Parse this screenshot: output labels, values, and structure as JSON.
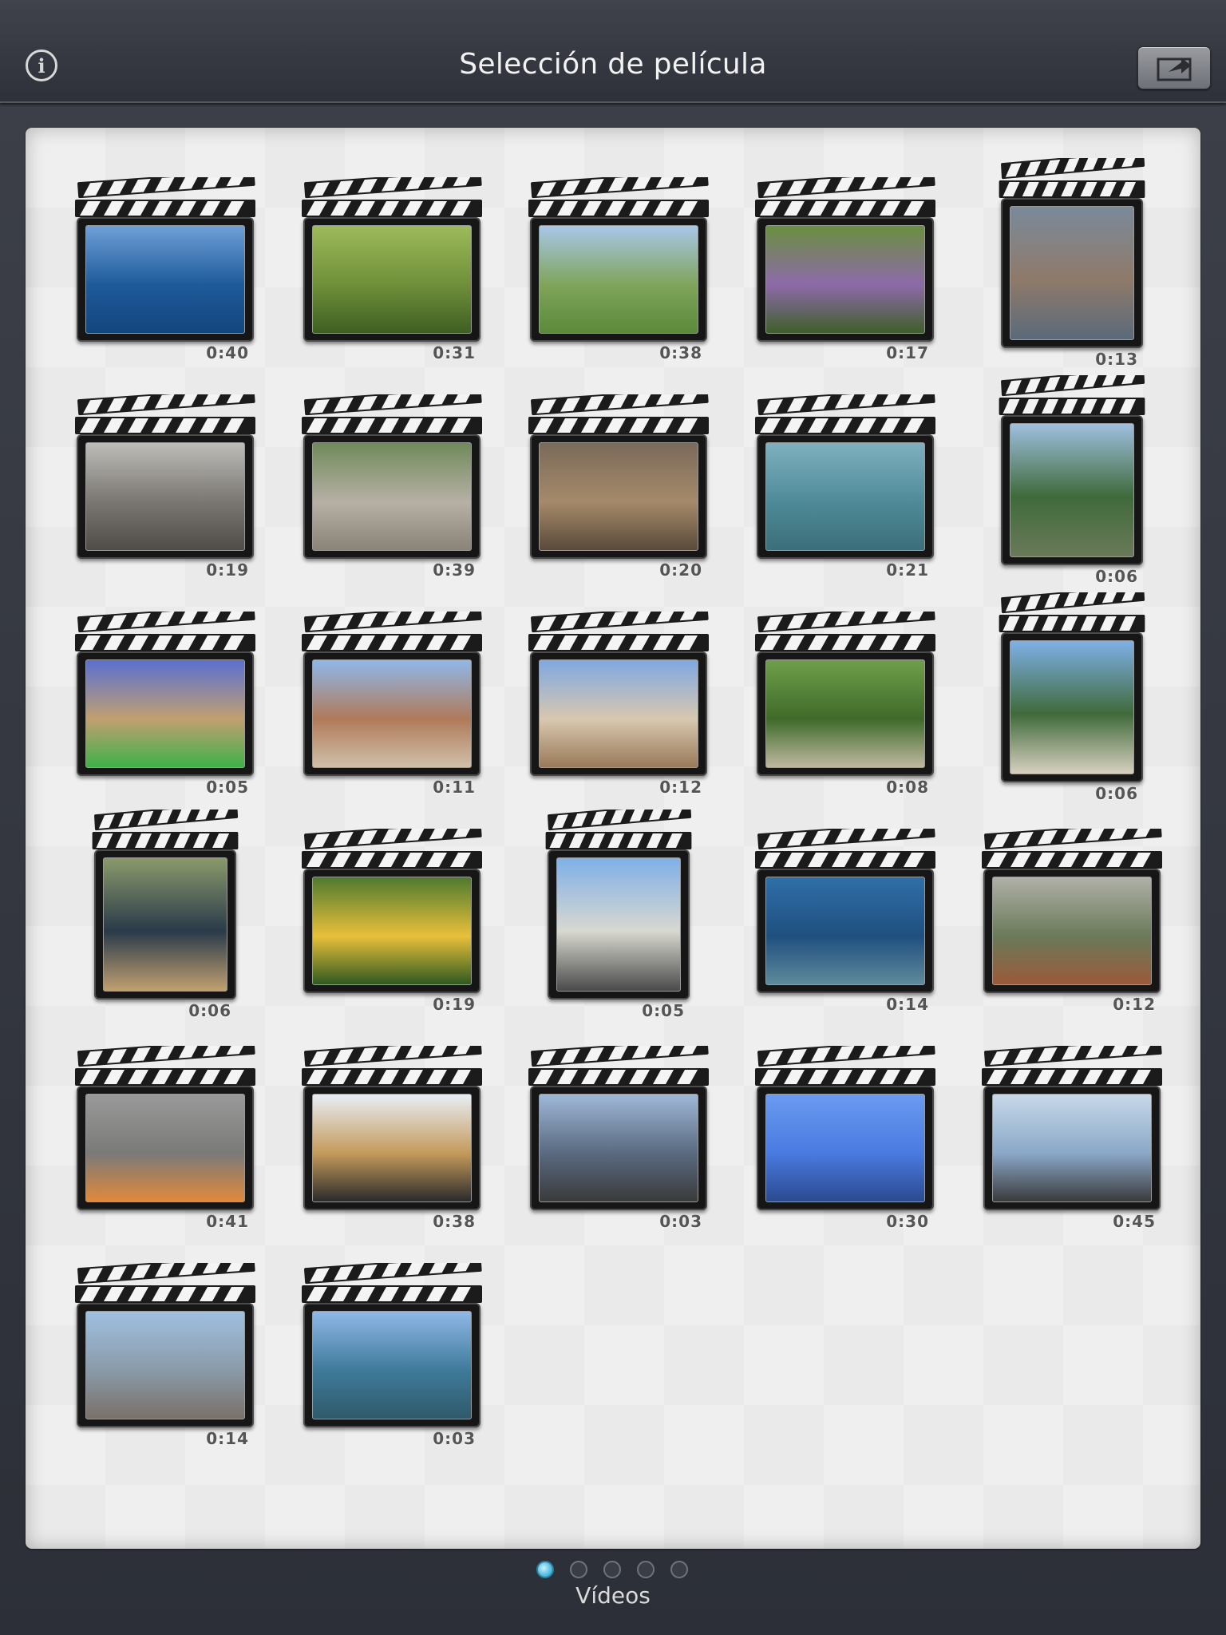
{
  "navbar": {
    "title": "Selección de película",
    "info_icon": "info-icon",
    "export_icon": "export-icon"
  },
  "clips": [
    {
      "duration": "0:40",
      "thumb": "sea",
      "colors": [
        "#6fa0d8",
        "#1e5a9a",
        "#14467e"
      ]
    },
    {
      "duration": "0:31",
      "thumb": "picnic",
      "colors": [
        "#9dbb5a",
        "#6f8f3a",
        "#3e5f22"
      ]
    },
    {
      "duration": "0:38",
      "thumb": "field",
      "colors": [
        "#a9c7e8",
        "#7fa45a",
        "#5b8a3a"
      ]
    },
    {
      "duration": "0:17",
      "thumb": "butterfly",
      "colors": [
        "#6a8f3f",
        "#8d6aa8",
        "#3f5f2a"
      ]
    },
    {
      "duration": "0:13",
      "thumb": "racetrack",
      "colors": [
        "#7a8a9a",
        "#8f7a6a",
        "#5a6a7a"
      ]
    },
    {
      "duration": "0:19",
      "thumb": "beach",
      "colors": [
        "#bdbdb8",
        "#7a7672",
        "#4f4b47"
      ]
    },
    {
      "duration": "0:39",
      "thumb": "red-panda",
      "colors": [
        "#6f8a5a",
        "#b7b0a5",
        "#8a8378"
      ]
    },
    {
      "duration": "0:20",
      "thumb": "shrew",
      "colors": [
        "#7a6a5a",
        "#a58a6a",
        "#5a4a3a"
      ]
    },
    {
      "duration": "0:21",
      "thumb": "aquarium",
      "colors": [
        "#7fb0c0",
        "#4f8a98",
        "#3b6f7a"
      ]
    },
    {
      "duration": "0:06",
      "thumb": "trees",
      "colors": [
        "#9fc0e0",
        "#3f6a3a",
        "#6a7a5a"
      ]
    },
    {
      "duration": "0:05",
      "thumb": "marmot",
      "colors": [
        "#5a6fd0",
        "#c0a070",
        "#3fb04a"
      ]
    },
    {
      "duration": "0:11",
      "thumb": "town",
      "colors": [
        "#8fb8e8",
        "#b07a5a",
        "#d0c0a8"
      ]
    },
    {
      "duration": "0:12",
      "thumb": "town2",
      "colors": [
        "#7fa8e0",
        "#d8c8b0",
        "#9a7a5a"
      ]
    },
    {
      "duration": "0:08",
      "thumb": "plants",
      "colors": [
        "#6f9f4a",
        "#3f6a2a",
        "#c0b8a0"
      ]
    },
    {
      "duration": "0:06",
      "thumb": "building",
      "colors": [
        "#7fb0e8",
        "#3f6a3a",
        "#d8d0c0"
      ]
    },
    {
      "duration": "0:06",
      "thumb": "car",
      "colors": [
        "#8a9a6a",
        "#2a3a4a",
        "#c0a070"
      ]
    },
    {
      "duration": "0:19",
      "thumb": "butterfly2",
      "colors": [
        "#4f7a2f",
        "#e8c03a",
        "#2f5a1f"
      ]
    },
    {
      "duration": "0:05",
      "thumb": "street",
      "colors": [
        "#7fb0e8",
        "#d8d8d0",
        "#4a4a4a"
      ]
    },
    {
      "duration": "0:14",
      "thumb": "turtle",
      "colors": [
        "#2f6fa8",
        "#1f4f7f",
        "#5f8a9a"
      ]
    },
    {
      "duration": "0:12",
      "thumb": "red-panda2",
      "colors": [
        "#b0b0a8",
        "#6a7a5a",
        "#9a5a3a"
      ]
    },
    {
      "duration": "0:41",
      "thumb": "kids",
      "colors": [
        "#9a9a9a",
        "#7a7a78",
        "#e08a3a"
      ]
    },
    {
      "duration": "0:38",
      "thumb": "origami",
      "colors": [
        "#e8eef5",
        "#c49a5a",
        "#2a2a2a"
      ]
    },
    {
      "duration": "0:03",
      "thumb": "sunset",
      "colors": [
        "#9fb8d8",
        "#5a6a80",
        "#3a3a3a"
      ]
    },
    {
      "duration": "0:30",
      "thumb": "dog",
      "colors": [
        "#6a9af0",
        "#4a7ae0",
        "#2a4a90"
      ]
    },
    {
      "duration": "0:45",
      "thumb": "lake",
      "colors": [
        "#c8d8e8",
        "#8aa8c8",
        "#3a3a3a"
      ]
    },
    {
      "duration": "0:14",
      "thumb": "gulls",
      "colors": [
        "#9fc0e0",
        "#8a9aa8",
        "#7a7068"
      ]
    },
    {
      "duration": "0:03",
      "thumb": "coast",
      "colors": [
        "#8fb8e8",
        "#3f7a9a",
        "#2f5a6a"
      ]
    }
  ],
  "pager": {
    "label": "Vídeos",
    "page_count": 5,
    "current_page": 1
  }
}
